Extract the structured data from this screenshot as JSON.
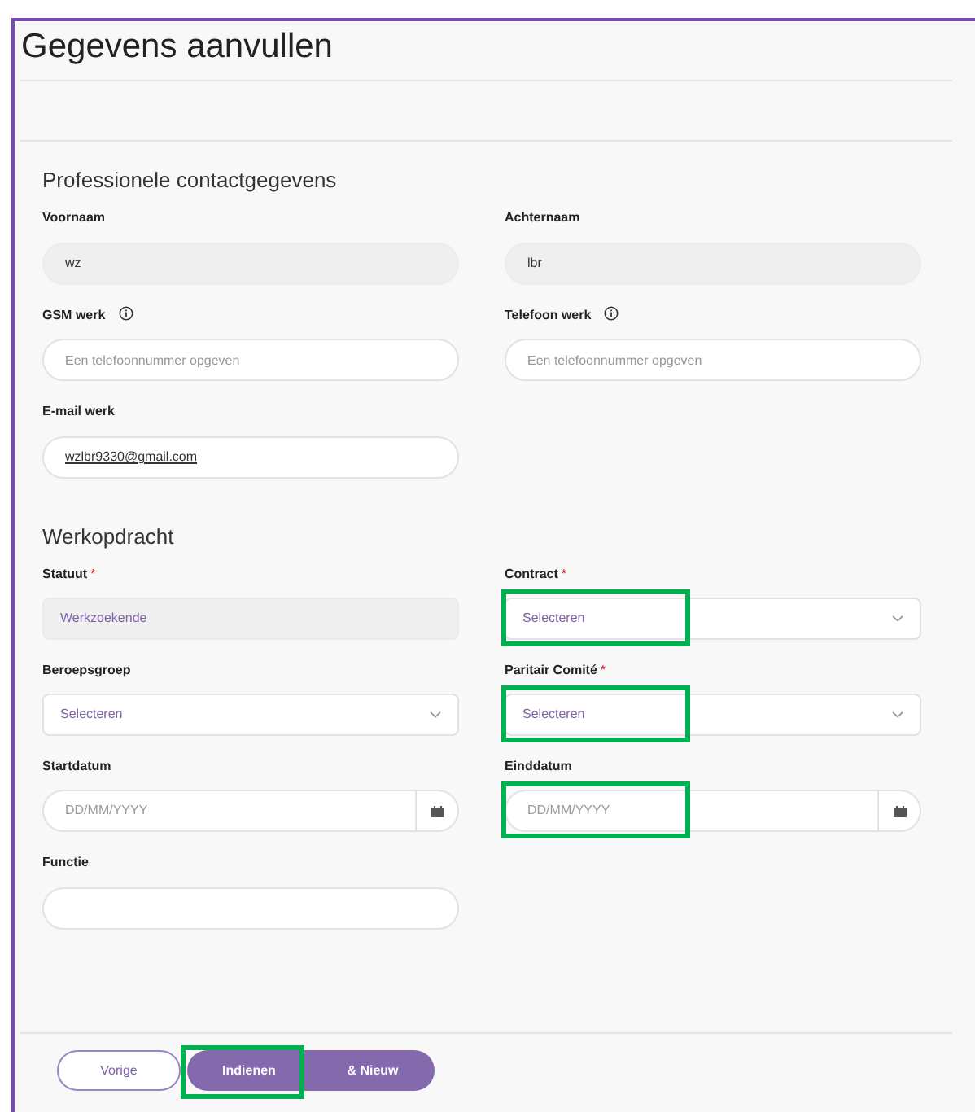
{
  "title": "Gegevens aanvullen",
  "sections": [
    {
      "heading": "Professionele contactgegevens",
      "fields": [
        {
          "kind": "text",
          "label": "Voornaam",
          "info": false,
          "value": "wz",
          "disabled": true,
          "highlighted": false
        },
        {
          "kind": "text",
          "label": "Achternaam",
          "info": false,
          "value": "lbr",
          "disabled": true,
          "highlighted": false
        },
        {
          "kind": "text",
          "label": "GSM werk",
          "info": true,
          "placeholder": "Een telefoonnummer opgeven",
          "disabled": false,
          "highlighted": false
        },
        {
          "kind": "text",
          "label": "Telefoon werk",
          "info": true,
          "placeholder": "Een telefoonnummer opgeven",
          "disabled": false,
          "highlighted": false
        },
        {
          "kind": "text",
          "label": "E-mail werk",
          "info": false,
          "value": "wzlbr9330@gmail.com",
          "disabled": false,
          "highlighted": false
        }
      ]
    },
    {
      "heading": "Werkopdracht",
      "fields": [
        {
          "kind": "select",
          "label": "Statuut",
          "required_mark": "*",
          "info": false,
          "value": "Werkzoekende",
          "disabled": true,
          "highlighted": false
        },
        {
          "kind": "select",
          "label": "Contract",
          "required_mark": "*",
          "info": false,
          "value": "Selecteren",
          "disabled": false,
          "highlighted": true
        },
        {
          "kind": "select",
          "label": "Beroepsgroep",
          "info": false,
          "value": "Selecteren",
          "disabled": false,
          "highlighted": false
        },
        {
          "kind": "select",
          "label": "Paritair Comité",
          "required_mark": "*",
          "info": false,
          "value": "Selecteren",
          "disabled": false,
          "highlighted": true
        },
        {
          "kind": "date",
          "label": "Startdatum",
          "info": false,
          "placeholder": "DD/MM/YYYY",
          "disabled": false,
          "highlighted": false
        },
        {
          "kind": "date",
          "label": "Einddatum",
          "info": false,
          "placeholder": "DD/MM/YYYY",
          "disabled": false,
          "highlighted": true
        },
        {
          "kind": "text",
          "label": "Functie",
          "info": false,
          "disabled": false,
          "highlighted": false
        }
      ]
    }
  ],
  "buttons": [
    {
      "kind": "outline",
      "label": "Vorige",
      "highlighted": false
    },
    {
      "kind": "primary",
      "label": "Indienen",
      "highlighted": true
    },
    {
      "kind": "primary",
      "label": "& Nieuw",
      "highlighted": false
    }
  ]
}
